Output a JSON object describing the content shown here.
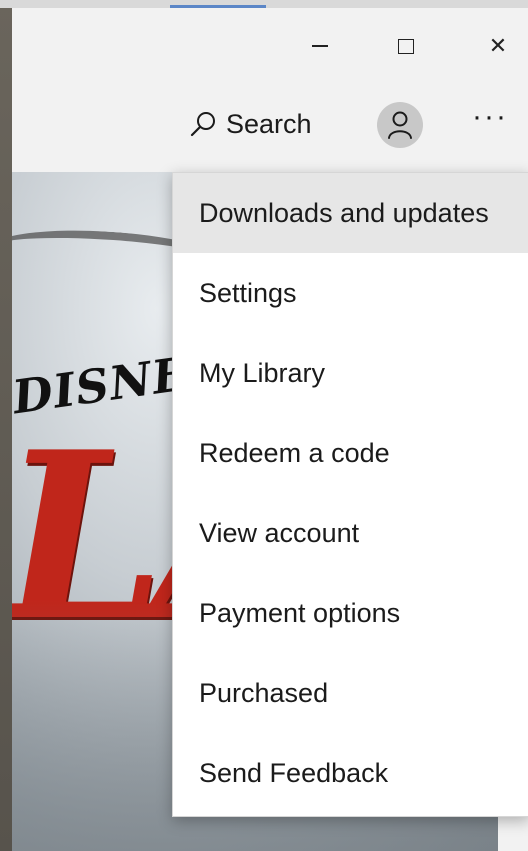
{
  "window_controls": {
    "minimize_icon": "minimize-icon",
    "maximize_icon": "maximize-icon",
    "close_icon": "close-icon",
    "close_glyph": "✕"
  },
  "toolbar": {
    "search_label": "Search",
    "search_icon": "search-icon",
    "account_icon": "person-icon",
    "more_label": "···"
  },
  "hero": {
    "brand_text": "DISNEY",
    "title_text": "LA"
  },
  "menu": {
    "items": [
      {
        "label": "Downloads and updates",
        "highlighted": true
      },
      {
        "label": "Settings"
      },
      {
        "label": "My Library"
      },
      {
        "label": "Redeem a code"
      },
      {
        "label": "View account"
      },
      {
        "label": "Payment options"
      },
      {
        "label": "Purchased"
      },
      {
        "label": "Send Feedback"
      }
    ]
  },
  "colors": {
    "accent": "#5b86c7",
    "menu_bg": "#ffffff",
    "menu_hover": "#e6e6e6",
    "title_red": "#c0261b"
  }
}
